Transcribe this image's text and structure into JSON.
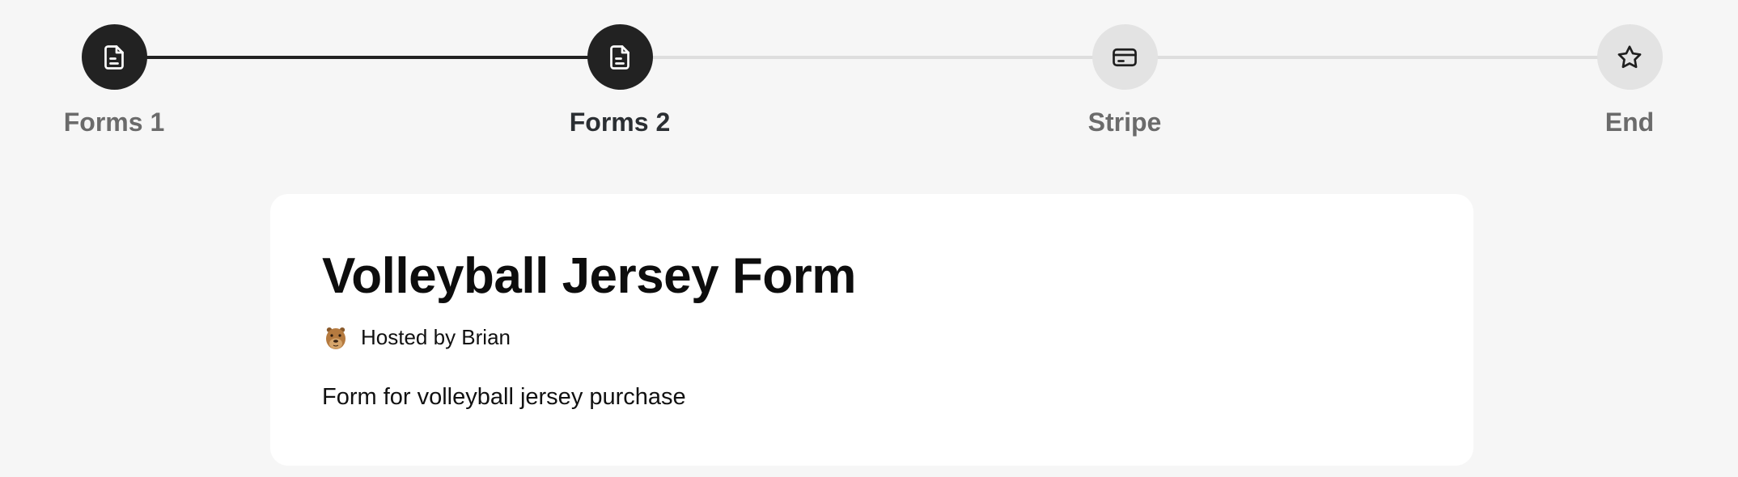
{
  "stepper": {
    "steps": [
      {
        "label": "Forms 1",
        "icon": "document-icon",
        "state": "completed"
      },
      {
        "label": "Forms 2",
        "icon": "document-icon",
        "state": "current"
      },
      {
        "label": "Stripe",
        "icon": "credit-card-icon",
        "state": "upcoming"
      },
      {
        "label": "End",
        "icon": "star-icon",
        "state": "upcoming"
      }
    ],
    "colors": {
      "active_fill": "#222222",
      "inactive_fill": "#e3e3e3",
      "active_line": "#222222",
      "inactive_line": "#dedede"
    }
  },
  "form": {
    "title": "Volleyball Jersey Form",
    "host_text": "Hosted by Brian",
    "host_avatar_icon": "capybara-avatar",
    "description": "Form for volleyball jersey purchase"
  }
}
